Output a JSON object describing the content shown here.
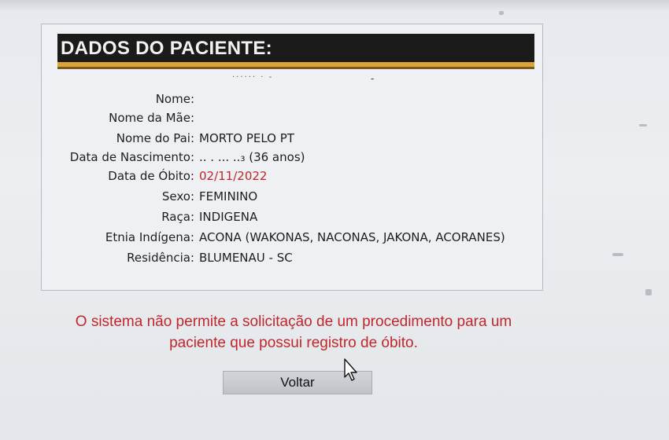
{
  "panel": {
    "title": "DADOS DO PACIENTE:",
    "blurred_text": "······ · -",
    "blurred_dash": "-",
    "fields": [
      {
        "label": "Nome:",
        "value": ""
      },
      {
        "label": "Nome da Mãe:",
        "value": ""
      },
      {
        "label": "Nome do Pai:",
        "value": "MORTO PELO PT"
      },
      {
        "label": "Data de Nascimento:",
        "value": ".. . ...       ..₃ (36 anos)"
      },
      {
        "label": "Data de Óbito:",
        "value": "02/11/2022"
      },
      {
        "label": "Sexo:",
        "value": "FEMININO"
      },
      {
        "label": "Raça:",
        "value": "INDIGENA"
      },
      {
        "label": "Etnia Indígena:",
        "value": "ACONA (WAKONAS, NACONAS, JAKONA, ACORANES)"
      },
      {
        "label": "Residência:",
        "value": "BLUMENAU - SC"
      }
    ]
  },
  "message": {
    "line1": "O sistema não permite a solicitação de um procedimento para um",
    "line2": "paciente que possui registro de óbito."
  },
  "button": {
    "label": "Voltar"
  },
  "colors": {
    "header_bg": "#1b1b1b",
    "header_stripe": "#d9a43a",
    "alert_red": "#c3262a"
  }
}
